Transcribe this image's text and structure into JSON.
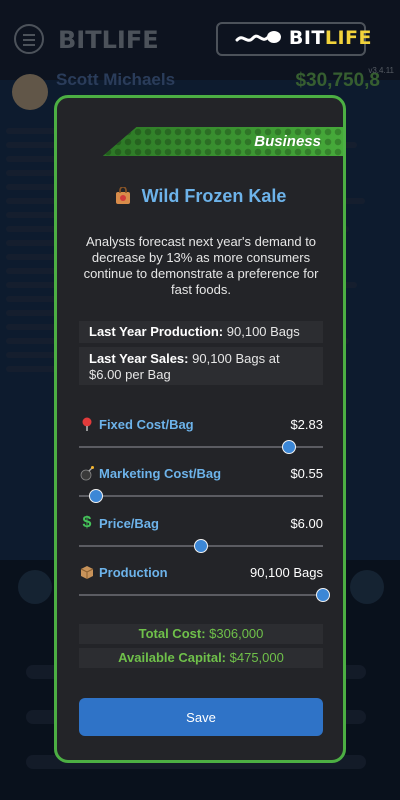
{
  "brand": {
    "bit": "BIT",
    "life": "LIFE"
  },
  "background": {
    "name": "Scott Michaels",
    "money": "$30,750,8",
    "version": "v3.4.11"
  },
  "modal": {
    "banner": "Business",
    "title": "Wild Frozen Kale",
    "description": "Analysts forecast next year's demand to decrease by 13% as more consumers continue to demonstrate a preference for fast foods.",
    "last_year_production": {
      "label": "Last Year Production:",
      "value": "90,100 Bags"
    },
    "last_year_sales": {
      "label": "Last Year Sales:",
      "value": "90,100 Bags at $6.00 per Bag"
    },
    "sliders": [
      {
        "label": "Fixed Cost/Bag",
        "value": "$2.83",
        "icon": "pin-icon",
        "level": 0.86
      },
      {
        "label": "Marketing Cost/Bag",
        "value": "$0.55",
        "icon": "bomb-icon",
        "level": 0.07
      },
      {
        "label": "Price/Bag",
        "value": "$6.00",
        "icon": "dollar-icon",
        "level": 0.5
      },
      {
        "label": "Production",
        "value": "90,100 Bags",
        "icon": "package-icon",
        "level": 1.0
      }
    ],
    "total_cost": {
      "label": "Total Cost:",
      "value": "$306,000"
    },
    "available_capital": {
      "label": "Available Capital:",
      "value": "$475,000"
    },
    "save_label": "Save"
  },
  "colors": {
    "accent_blue": "#6db3ea",
    "green_border": "#4caf43",
    "green_text": "#6fc04a",
    "button_blue": "#2f73c7"
  }
}
